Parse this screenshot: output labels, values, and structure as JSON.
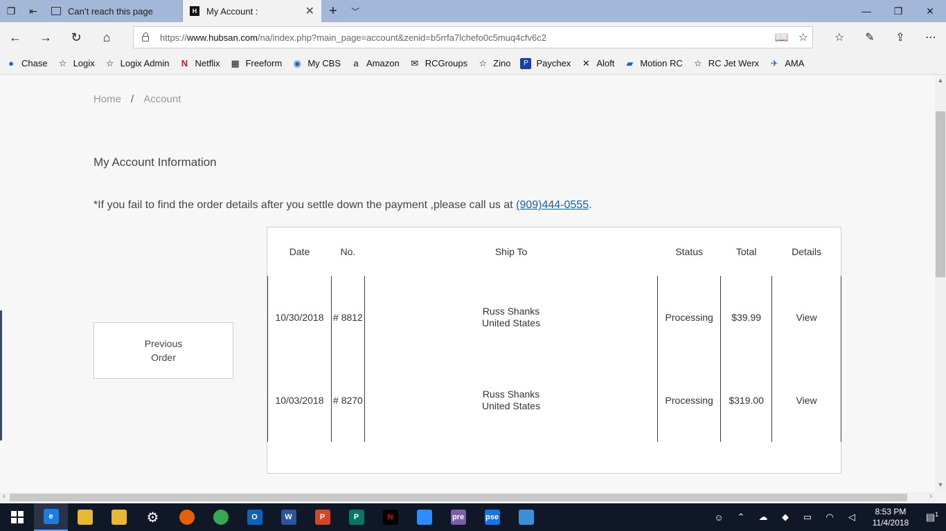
{
  "browser": {
    "tabs": [
      {
        "label": "Can’t reach this page",
        "active": false
      },
      {
        "label": "My Account :",
        "active": true
      }
    ],
    "url_prefix": "https://",
    "url_host": "www.hubsan.com",
    "url_path": "/na/index.php?main_page=account&zenid=b5rrfa7lchefo0c5muq4cfv6c2",
    "favorites": [
      {
        "label": "Chase",
        "icon": "chase-icon",
        "color": "#1a64c8"
      },
      {
        "label": "Logix",
        "icon": "star-icon"
      },
      {
        "label": "Logix Admin",
        "icon": "star-icon"
      },
      {
        "label": "Netflix",
        "icon": "netflix-icon",
        "color": "#e50914"
      },
      {
        "label": "Freeform",
        "icon": "freeform-icon"
      },
      {
        "label": "My CBS",
        "icon": "cbs-icon",
        "color": "#1a64c8"
      },
      {
        "label": "Amazon",
        "icon": "amazon-icon"
      },
      {
        "label": "RCGroups",
        "icon": "rcgroups-icon"
      },
      {
        "label": "Zino",
        "icon": "star-icon"
      },
      {
        "label": "Paychex",
        "icon": "paychex-icon",
        "color": "#1d3fa8"
      },
      {
        "label": "Aloft",
        "icon": "aloft-icon"
      },
      {
        "label": "Motion RC",
        "icon": "motionrc-icon",
        "color": "#1a64c8"
      },
      {
        "label": "RC Jet Werx",
        "icon": "star-icon"
      },
      {
        "label": "AMA",
        "icon": "ama-icon",
        "color": "#1a64c8"
      }
    ]
  },
  "page": {
    "breadcrumb": {
      "home": "Home",
      "separator": "/",
      "current": "Account"
    },
    "title": "My Account Information",
    "notice_text": "*If you fail to find the order details after you settle down the payment ,please call us at ",
    "notice_phone": "(909)444-0555",
    "notice_end": ".",
    "prev_order_line1": "Previous",
    "prev_order_line2": "Order",
    "orders": {
      "headers": {
        "date": "Date",
        "no": "No.",
        "ship_to": "Ship To",
        "status": "Status",
        "total": "Total",
        "details": "Details"
      },
      "rows": [
        {
          "date": "10/30/2018",
          "no": "# 8812",
          "ship_name": "Russ Shanks",
          "ship_country": "United States",
          "status": "Processing",
          "total": "$39.99",
          "details": "View"
        },
        {
          "date": "10/03/2018",
          "no": "# 8270",
          "ship_name": "Russ Shanks",
          "ship_country": "United States",
          "status": "Processing",
          "total": "$319.00",
          "details": "View"
        }
      ]
    }
  },
  "taskbar": {
    "time": "8:53 PM",
    "date": "11/4/2018",
    "notification_count": "1",
    "apps": [
      {
        "name": "edge-icon",
        "color": "#1b7de0",
        "glyph": "e",
        "active": true
      },
      {
        "name": "file-explorer-icon",
        "color": "#e8b830",
        "glyph": ""
      },
      {
        "name": "file-search-icon",
        "color": "#e8b830",
        "glyph": ""
      },
      {
        "name": "settings-icon",
        "color": "#101828",
        "glyph": "⚙"
      },
      {
        "name": "firefox-icon",
        "color": "#e66000",
        "glyph": ""
      },
      {
        "name": "chrome-icon",
        "color": "#34a853",
        "glyph": ""
      },
      {
        "name": "outlook-icon",
        "color": "#0a64b8",
        "glyph": "O"
      },
      {
        "name": "word-icon",
        "color": "#2b579a",
        "glyph": "W"
      },
      {
        "name": "powerpoint-icon",
        "color": "#d24726",
        "glyph": "P"
      },
      {
        "name": "publisher-icon",
        "color": "#077568",
        "glyph": "P"
      },
      {
        "name": "netflix-icon",
        "color": "#000000",
        "glyph": "N"
      },
      {
        "name": "zoom-icon",
        "color": "#2d8cff",
        "glyph": ""
      },
      {
        "name": "premiere-elements-icon",
        "color": "#7b5ea7",
        "glyph": "pre"
      },
      {
        "name": "photoshop-elements-icon",
        "color": "#1473e6",
        "glyph": "pse"
      },
      {
        "name": "control-panel-icon",
        "color": "#3a8fd8",
        "glyph": ""
      }
    ]
  }
}
